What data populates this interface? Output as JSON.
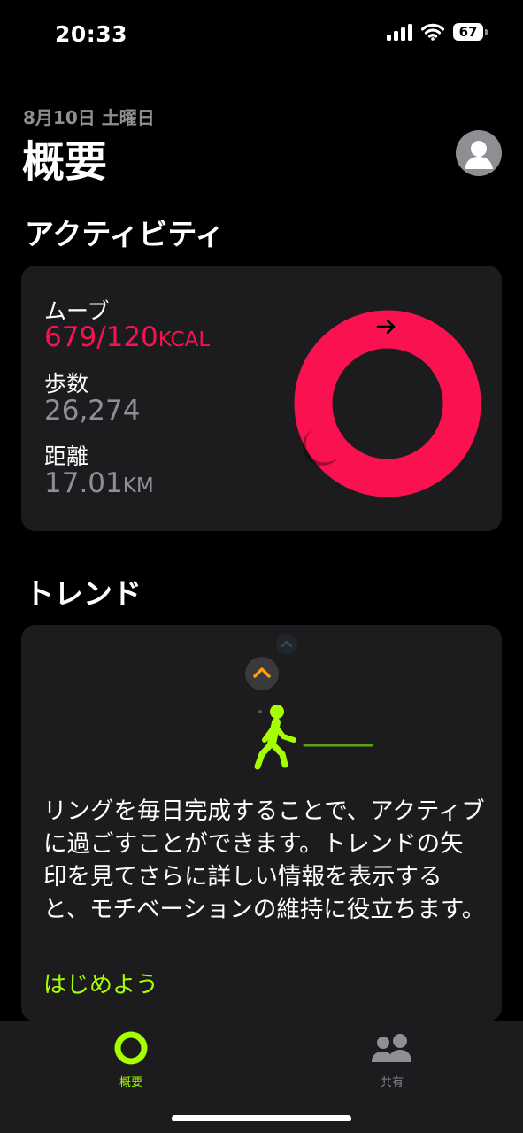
{
  "status_bar": {
    "time": "20:33",
    "battery": "67"
  },
  "header": {
    "date": "8月10日 土曜日",
    "title": "概要"
  },
  "activity": {
    "section_title": "アクティビティ",
    "move_label": "ムーブ",
    "move_value": "679/120",
    "move_unit": "KCAL",
    "steps_label": "歩数",
    "steps_value": "26,274",
    "distance_label": "距離",
    "distance_value": "17.01",
    "distance_unit": "KM",
    "ring_progress": 5.66,
    "colors": {
      "move": "#fa114f"
    }
  },
  "trends": {
    "section_title": "トレンド",
    "description": "リングを毎日完成することで、アクティブに過ごすことができます。トレンドの矢印を見てさらに詳しい情報を表示すると、モチベーションの維持に役立ちます。",
    "cta": "はじめよう",
    "colors": {
      "accent": "#a6ff00",
      "arrow": "#ff9f0a"
    }
  },
  "tabbar": {
    "tabs": [
      {
        "label": "概要",
        "icon": "activity-ring-icon",
        "selected": true
      },
      {
        "label": "共有",
        "icon": "people-icon",
        "selected": false
      }
    ]
  }
}
